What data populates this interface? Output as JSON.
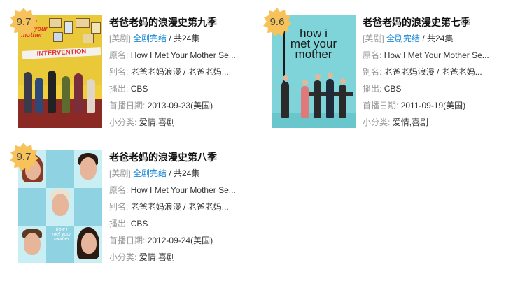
{
  "cards": [
    {
      "score": "9.7",
      "title": "老爸老妈的浪漫史第九季",
      "tag": "[美剧]",
      "status": "全剧完结",
      "episodes": "/ 共24集",
      "original_label": "原名:",
      "original": "How I Met Your Mother Se...",
      "alias_label": "别名:",
      "alias": "老爸老妈浪漫 / 老爸老妈...",
      "network_label": "播出:",
      "network": "CBS",
      "premiere_label": "首播日期:",
      "premiere": "2013-09-23(美国)",
      "genre_label": "小分类:",
      "genre": "爱情,喜剧",
      "poster": {
        "logo_lines": [
          "how i",
          "met your",
          "mother"
        ],
        "banner": "INTERVENTION"
      }
    },
    {
      "score": "9.6",
      "title": "老爸老妈的浪漫史第七季",
      "tag": "[美剧]",
      "status": "全剧完结",
      "episodes": "/ 共24集",
      "original_label": "原名:",
      "original": "How I Met Your Mother Se...",
      "alias_label": "别名:",
      "alias": "老爸老妈浪漫 / 老爸老妈...",
      "network_label": "播出:",
      "network": "CBS",
      "premiere_label": "首播日期:",
      "premiere": "2011-09-19(美国)",
      "genre_label": "小分类:",
      "genre": "爱情,喜剧",
      "poster": {
        "logo_lines": [
          "how i",
          "met your",
          "mother"
        ]
      }
    },
    {
      "score": "9.7",
      "title": "老爸老妈的浪漫史第八季",
      "tag": "[美剧]",
      "status": "全剧完结",
      "episodes": "/ 共24集",
      "original_label": "原名:",
      "original": "How I Met Your Mother Se...",
      "alias_label": "别名:",
      "alias": "老爸老妈浪漫 / 老爸老妈...",
      "network_label": "播出:",
      "network": "CBS",
      "premiere_label": "首播日期:",
      "premiere": "2012-09-24(美国)",
      "genre_label": "小分类:",
      "genre": "爱情,喜剧",
      "poster": {
        "logo_lines": [
          "how i",
          "met your",
          "mother"
        ]
      }
    }
  ],
  "colors": {
    "status_link": "#1a8ad6",
    "badge": "#f7c25a",
    "label": "#999999"
  }
}
